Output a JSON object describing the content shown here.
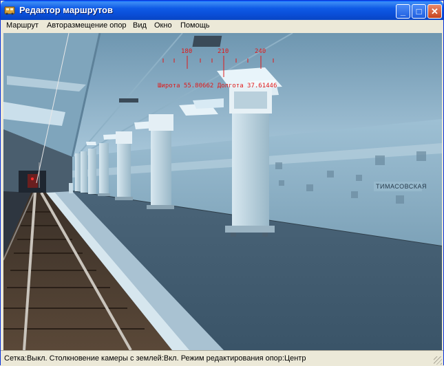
{
  "window": {
    "title": "Редактор маршрутов",
    "controls": {
      "minimize": "_",
      "maximize": "□",
      "close": "✕"
    }
  },
  "menu": {
    "items": [
      "Маршрут",
      "Авторазмещение опор",
      "Вид",
      "Окно",
      "Помощь"
    ]
  },
  "hud": {
    "compass_labels": [
      "180",
      "210",
      "240"
    ],
    "coordinates": "Широта 55.80662 Долгота 37.61446"
  },
  "scene": {
    "station_sign": "ТИМАСОВСКАЯ"
  },
  "statusbar": {
    "text": "Сетка:Выкл. Столкновение камеры с землей:Вкл. Режим редактирования опор:Центр"
  },
  "colors": {
    "titlebar": "#0a4fd8",
    "hud_red": "#e01818",
    "wall": "#8fb5cc",
    "column": "#c7dbe6"
  }
}
